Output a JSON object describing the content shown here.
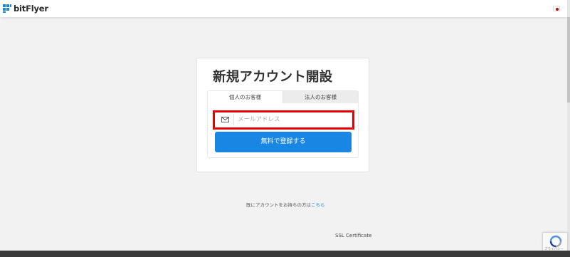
{
  "header": {
    "brand": "bitFlyer",
    "language_flag": "japan-flag-icon"
  },
  "signup": {
    "title": "新規アカウント開設",
    "tabs": [
      {
        "label": "個人のお客様",
        "active": true
      },
      {
        "label": "法人のお客様",
        "active": false
      }
    ],
    "email": {
      "value": "",
      "placeholder": "メールアドレス",
      "icon": "mail-icon",
      "highlight_color": "#e60000"
    },
    "submit_label": "無料で登録する"
  },
  "login_prompt": {
    "text": "既にアカウントをお持ちの方は",
    "link": "こちら"
  },
  "ssl_label": "SSL Certificate",
  "recaptcha_caption": "プライバシー",
  "colors": {
    "accent": "#1a86e3",
    "brand": "#1a86d8",
    "background": "#f2f2f2"
  }
}
